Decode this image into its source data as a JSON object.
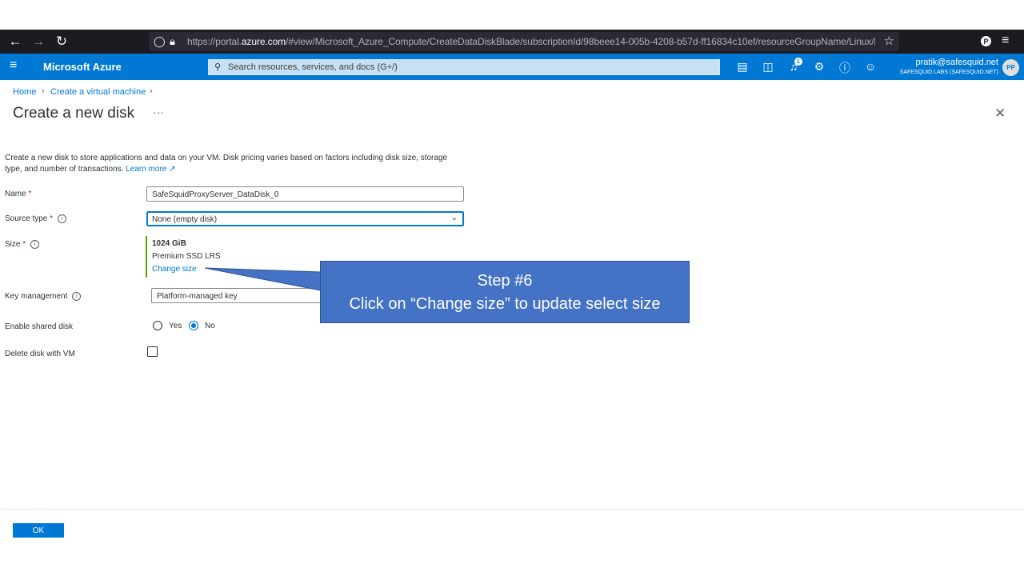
{
  "browser": {
    "url_prefix": "https://portal.",
    "url_domain": "azure.com",
    "url_rest": "/#view/Microsoft_Azure_Compute/CreateDataDiskBlade/subscriptionId/98beee14-005b-4208-b57d-ff16834c10ef/resourceGroupName/Linux/location/c",
    "profile_letter": "P"
  },
  "azure": {
    "brand": "Microsoft Azure",
    "search_placeholder": "Search resources, services, and docs (G+/)",
    "notification_count": "1",
    "user_email": "pratik@safesquid.net",
    "user_org": "SAFESQUID LABS (SAFESQUID.NET)",
    "avatar_initials": "PP"
  },
  "breadcrumb": [
    "Home",
    "Create a virtual machine"
  ],
  "page": {
    "title": "Create a new disk",
    "ellipsis": "···",
    "description": "Create a new disk to store applications and data on your VM. Disk pricing varies based on factors including disk size, storage type, and number of transactions.",
    "learn_more": "Learn more"
  },
  "form": {
    "name_label": "Name",
    "name_value": "SafeSquidProxyServer_DataDisk_0",
    "source_type_label": "Source type",
    "source_type_value": "None (empty disk)",
    "size_label": "Size",
    "size_value": "1024 GiB",
    "size_tier": "Premium SSD LRS",
    "change_size": "Change size",
    "key_management_label": "Key management",
    "key_management_value": "Platform-managed key",
    "shared_disk_label": "Enable shared disk",
    "shared_yes": "Yes",
    "shared_no": "No",
    "shared_selected": "No",
    "delete_with_vm_label": "Delete disk with VM",
    "delete_with_vm_checked": false
  },
  "footer": {
    "ok_label": "OK"
  },
  "callout": {
    "line1": "Step #6",
    "line2": "Click on “Change size” to update select size"
  },
  "colors": {
    "azure_blue": "#0078d4",
    "callout": "#4472c4",
    "browser_dark": "#1c1b22"
  }
}
